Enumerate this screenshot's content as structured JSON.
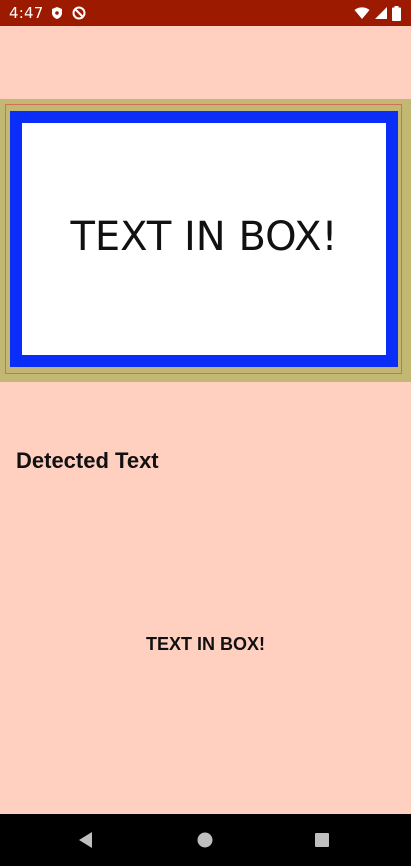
{
  "status_bar": {
    "time": "4:47",
    "background_color": "#9b1a00",
    "left_icons": [
      "shield-icon",
      "no-sync-icon"
    ],
    "right_icons": [
      "wifi-icon",
      "cellular-signal-icon",
      "battery-icon"
    ]
  },
  "preview": {
    "box_text": "TEXT IN BOX!",
    "box_border_color": "#0a2df7",
    "panel_color": "#c2b873"
  },
  "result": {
    "heading": "Detected Text",
    "detected_text": "TEXT IN BOX!"
  },
  "navigation": {
    "buttons": [
      "back-icon",
      "home-icon",
      "recents-icon"
    ]
  },
  "theme": {
    "background": "#ffd0bf"
  }
}
